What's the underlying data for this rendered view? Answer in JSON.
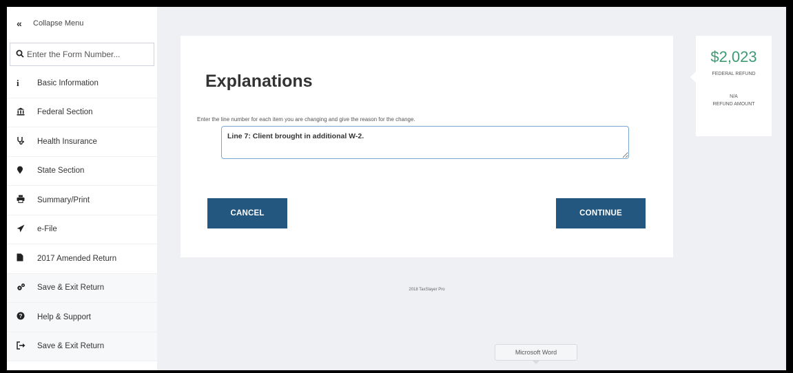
{
  "sidebar": {
    "collapse": {
      "icon": "double-chevron-left-icon",
      "glyph": "«",
      "label": "Collapse Menu"
    },
    "search": {
      "icon": "search-icon",
      "glyph": "⚲",
      "placeholder": "Enter the Form Number..."
    },
    "items": [
      {
        "icon": "info-icon",
        "glyph": "i",
        "label": "Basic Information"
      },
      {
        "icon": "bank-icon",
        "glyph": "🏛",
        "label": "Federal Section"
      },
      {
        "icon": "stethoscope-icon",
        "glyph": "☤",
        "label": "Health Insurance"
      },
      {
        "icon": "map-pin-icon",
        "glyph": "●",
        "label": "State Section"
      },
      {
        "icon": "printer-icon",
        "glyph": "⎙",
        "label": "Summary/Print"
      },
      {
        "icon": "paper-plane-icon",
        "glyph": "➤",
        "label": "e-File"
      },
      {
        "icon": "document-icon",
        "glyph": "▮",
        "label": "2017 Amended Return"
      },
      {
        "icon": "cogs-icon",
        "glyph": "⚙",
        "label": "Save & Exit Return"
      },
      {
        "icon": "question-circle-icon",
        "glyph": "?",
        "label": "Help & Support"
      },
      {
        "icon": "sign-out-icon",
        "glyph": "⇥",
        "label": "Save & Exit Return"
      }
    ]
  },
  "main": {
    "title": "Explanations",
    "instructions": "Enter the line number for each item you are changing and give the reason for the change.",
    "explanation_value": "Line 7: Client brought in additional W-2.",
    "cancel_label": "CANCEL",
    "continue_label": "CONTINUE"
  },
  "refund": {
    "federal_amount": "$2,023",
    "federal_label": "FEDERAL REFUND",
    "refund_amount_value": "N/A",
    "refund_amount_label": "REFUND AMOUNT",
    "amount_color": "#3d9b74"
  },
  "footer": {
    "copyright": "2018 TaxSlayer Pro"
  },
  "taskbar": {
    "tooltip": "Microsoft Word"
  },
  "colors": {
    "button": "#245780",
    "background": "#eef0f3"
  }
}
